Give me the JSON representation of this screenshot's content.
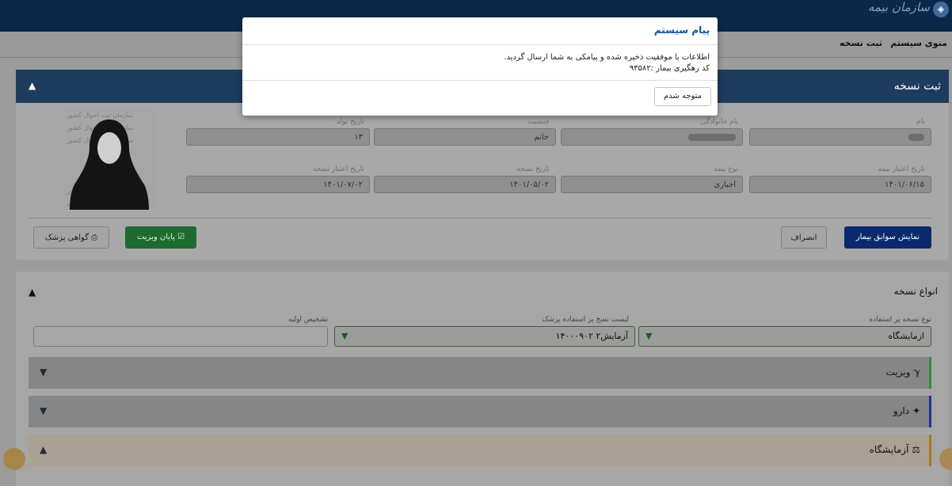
{
  "header": {
    "brand": "سازمان بیمه",
    "logo_icon": "organization-logo-icon"
  },
  "menu": {
    "items": [
      {
        "label": "منوی سیستم"
      },
      {
        "label": "ثبت نسخه"
      }
    ]
  },
  "prescription_panel": {
    "title": "ثبت نسخه",
    "fields": [
      {
        "label": "نام",
        "value": ""
      },
      {
        "label": "نام خانوادگی",
        "value": ""
      },
      {
        "label": "جنسیت",
        "value": "خانم"
      },
      {
        "label": "تاریخ تولد",
        "value": "۱۳"
      },
      {
        "label": "تاریخ اعتبار بیمه",
        "value": "۱۴۰۱/۰۶/۱۵"
      },
      {
        "label": "نوع بیمه",
        "value": "اجباری"
      },
      {
        "label": "تاریخ نسخه",
        "value": "۱۴۰۱/۰۵/۰۲"
      },
      {
        "label": "تاریخ اعتبار نسخه",
        "value": "۱۴۰۱/۰۷/۰۲"
      }
    ],
    "photo_watermark": "سازمان ثبت احوال کشور",
    "buttons": {
      "history": "نمایش سوابق بیمار",
      "cancel": "انصراف",
      "end_visit": "پایان ویزیت",
      "certificate": "گواهی پزشک"
    }
  },
  "types_panel": {
    "title": "انواع نسخه",
    "fields": [
      {
        "label": "نوع نسخه پر استفاده",
        "value": "ازمایشگاه"
      },
      {
        "label": "لیست نسخ پر استفاده پزشک",
        "value": "آزمایش۲ ۱۴۰۰۰۹۰۲"
      },
      {
        "label": "تشخیص اولیه",
        "value": ""
      }
    ],
    "sections": [
      {
        "label": "ویزیت",
        "icon": "stethoscope-icon"
      },
      {
        "label": "دارو",
        "icon": "pill-icon"
      },
      {
        "label": "آزمایشگاه",
        "icon": "flask-icon"
      }
    ]
  },
  "modal": {
    "title": "پیام سیستم",
    "line1": "اطلاعات با موفقیت ذخیره شده و پیامکی به شما ارسال گردید.",
    "line2": "کد رهگیری بیمار :۹۳۵۸۲",
    "ok": "متوجه شدم"
  },
  "colors": {
    "primary": "#0b2a6e",
    "success": "#1e6a30",
    "link": "#0d4fa4"
  }
}
